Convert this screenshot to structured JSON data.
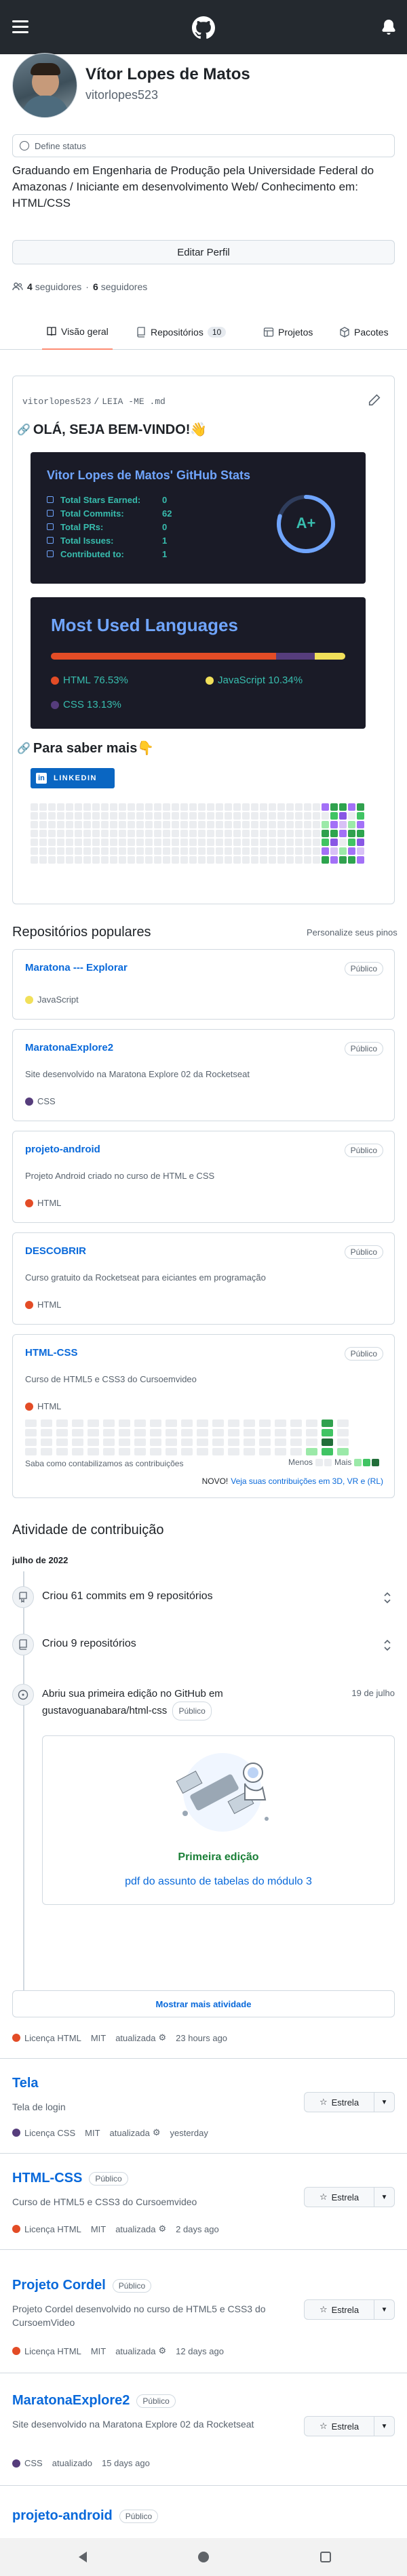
{
  "profile": {
    "name": "Vítor Lopes de Matos",
    "username": "vitorlopes523",
    "status": "Define status",
    "bio": "Graduando em Engenharia de Produção pela Universidade Federal do Amazonas / Iniciante em desenvolvimento Web/ Conhecimento em: HTML/CSS",
    "edit_button": "Editar Perfil",
    "followers_count": "4",
    "followers_label": "seguidores",
    "sep": "·",
    "following_count": "6",
    "following_label": "seguidores"
  },
  "tabs": [
    {
      "label": "Visão geral",
      "selected": true
    },
    {
      "label": "Repositórios",
      "count": "10"
    },
    {
      "label": "Projetos"
    },
    {
      "label": "Pacotes"
    }
  ],
  "readme": {
    "path_user": "vitorlopes523",
    "path_sep": "/",
    "path_file": "LEIA -ME .md",
    "heading": "OLÁ, SEJA BEM-VINDO!👋",
    "stats_title": "Vitor Lopes de Matos' GitHub Stats",
    "stats": [
      {
        "label": "Total Stars Earned:",
        "value": "0"
      },
      {
        "label": "Total Commits:",
        "value": "62"
      },
      {
        "label": "Total PRs:",
        "value": "0"
      },
      {
        "label": "Total Issues:",
        "value": "1"
      },
      {
        "label": "Contributed to:",
        "value": "1"
      }
    ],
    "grade": "A+",
    "lang_title": "Most Used Languages",
    "languages": [
      {
        "name": "HTML",
        "percent": "76.53%",
        "value": 76.53,
        "color": "#e34c26"
      },
      {
        "name": "JavaScript",
        "percent": "10.34%",
        "value": 10.34,
        "color": "#f1e05a"
      },
      {
        "name": "CSS",
        "percent": "13.13%",
        "value": 13.13,
        "color": "#563d7c"
      }
    ],
    "more_heading": "Para saber mais👇",
    "linkedin": "LINKEDIN"
  },
  "popular": {
    "title": "Repositórios populares",
    "customize": "Personalize seus pinos",
    "repos": [
      {
        "name": "Maratona --- Explorar",
        "visibility": "Público",
        "description": "",
        "language": "JavaScript",
        "color": "#f1e05a"
      },
      {
        "name": "MaratonaExplore2",
        "visibility": "Público",
        "description": "Site desenvolvido na Maratona Explore 02 da Rocketseat",
        "language": "CSS",
        "color": "#563d7c"
      },
      {
        "name": "projeto-android",
        "visibility": "Público",
        "description": "Projeto Android criado no curso de HTML e CSS",
        "language": "HTML",
        "color": "#e34c26"
      },
      {
        "name": "DESCOBRIR",
        "visibility": "Público",
        "description": "Curso gratuito da Rocketseat para eiciantes em programação",
        "language": "HTML",
        "color": "#e34c26"
      },
      {
        "name": "HTML-CSS",
        "visibility": "Público",
        "description": "Curso de HTML5 e CSS3 do Cursoemvideo",
        "language": "HTML",
        "color": "#e34c26"
      }
    ]
  },
  "contrib_graph": {
    "learn": "Saba como contabilizamos as contribuições",
    "less": "Menos",
    "more": "Mais",
    "news_prefix": "NOVO!",
    "news_link": "Veja suas contribuições em 3D, VR e (RL)"
  },
  "activity": {
    "title": "Atividade de contribuição",
    "month": "julho de 2022",
    "items": [
      {
        "text": "Criou 61 commits em 9 repositórios"
      },
      {
        "text": "Criou 9 repositórios"
      }
    ],
    "issue_text": "Abriu sua primeira edição no GitHub em gustavoguanabara/html-css",
    "issue_badge": "Público",
    "issue_date": "19 de julho",
    "first_issue_title": "Primeira edição",
    "first_issue_link": "pdf do assunto de tabelas do módulo 3",
    "show_more": "Mostrar mais atividade"
  },
  "list": {
    "top": {
      "license": "Licença HTML",
      "license_type": "MIT",
      "updated": "atualizada",
      "time": "23 hours ago"
    },
    "repos": [
      {
        "name": "Tela",
        "visibility": "",
        "description": "Tela de login",
        "language": "Licença CSS",
        "color": "#563d7c",
        "license": "MIT",
        "updated": "atualizada",
        "time": "yesterday",
        "star": "Estrela"
      },
      {
        "name": "HTML-CSS",
        "visibility": "Público",
        "description": "Curso de HTML5 e CSS3 do Cursoemvideo",
        "language": "Licença HTML",
        "color": "#e34c26",
        "license": "MIT",
        "updated": "atualizada",
        "time": "2 days ago",
        "star": "Estrela"
      },
      {
        "name": "Projeto Cordel",
        "visibility": "Público",
        "description": "Projeto Cordel desenvolvido no curso de HTML5 e CSS3 do CursoemVideo",
        "language": "Licença HTML",
        "color": "#e34c26",
        "license": "MIT",
        "updated": "atualizada",
        "time": "12 days ago",
        "star": "Estrela"
      },
      {
        "name": "MaratonaExplore2",
        "visibility": "Público",
        "description": "Site desenvolvido na Maratona Explore 02 da Rocketseat",
        "language": "CSS",
        "color": "#563d7c",
        "license": "",
        "updated": "atualizado",
        "time": "15 days ago",
        "star": "Estrela"
      }
    ],
    "last_name": "projeto-android",
    "last_visibility": "Público"
  },
  "colors": {
    "header": "#24292f",
    "link": "#0969da",
    "stats_bg": "#1a1b27",
    "stats_title": "#70a5fd",
    "stats_text": "#38bdae"
  }
}
